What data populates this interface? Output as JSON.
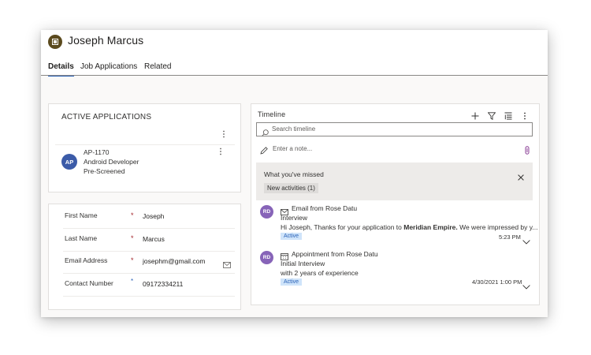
{
  "record": {
    "name": "Joseph Marcus"
  },
  "tabs": [
    {
      "label": "Details",
      "active": true
    },
    {
      "label": "Job Applications",
      "active": false
    },
    {
      "label": "Related",
      "active": false
    }
  ],
  "active_applications": {
    "title": "ACTIVE APPLICATIONS",
    "items": [
      {
        "initials": "AP",
        "id": "AP-1170",
        "position": "Android Developer",
        "stage": "Pre-Screened",
        "avatar_color": "#3b5ba8"
      }
    ]
  },
  "contact_fields": [
    {
      "label": "First Name",
      "value": "Joseph",
      "required_color": "#a4262c"
    },
    {
      "label": "Last Name",
      "value": "Marcus",
      "required_color": "#a4262c"
    },
    {
      "label": "Email Address",
      "value": "josephm@gmail.com",
      "required_color": "#a4262c",
      "icon": "email-compose-icon"
    },
    {
      "label": "Contact Number",
      "value": "09172334211",
      "required_color": "#2b62b7"
    }
  ],
  "timeline": {
    "title": "Timeline",
    "search_placeholder": "Search timeline",
    "note_placeholder": "Enter a note...",
    "missed": {
      "title": "What you've missed",
      "chip": "New activities (1)"
    },
    "activities": [
      {
        "type_icon": "email-icon",
        "initials": "RD",
        "avatar_color": "#8764b8",
        "title": "Email from Rose Datu",
        "subtitle": "Interview",
        "body_prefix": "Hi Joseph,   Thanks for your application to ",
        "body_bold": "Meridian Empire.",
        "body_suffix": " We were impressed by y...",
        "status": "Active",
        "time": "5:23 PM"
      },
      {
        "type_icon": "calendar-icon",
        "initials": "RD",
        "avatar_color": "#8764b8",
        "title": "Appointment from Rose Datu",
        "subtitle": "Initial Interview",
        "body": "with 2 years of experience",
        "status": "Active",
        "time": "4/30/2021 1:00 PM"
      }
    ]
  },
  "colors": {
    "accent": "#2b62b7",
    "status_bg": "#cfe4fa"
  }
}
